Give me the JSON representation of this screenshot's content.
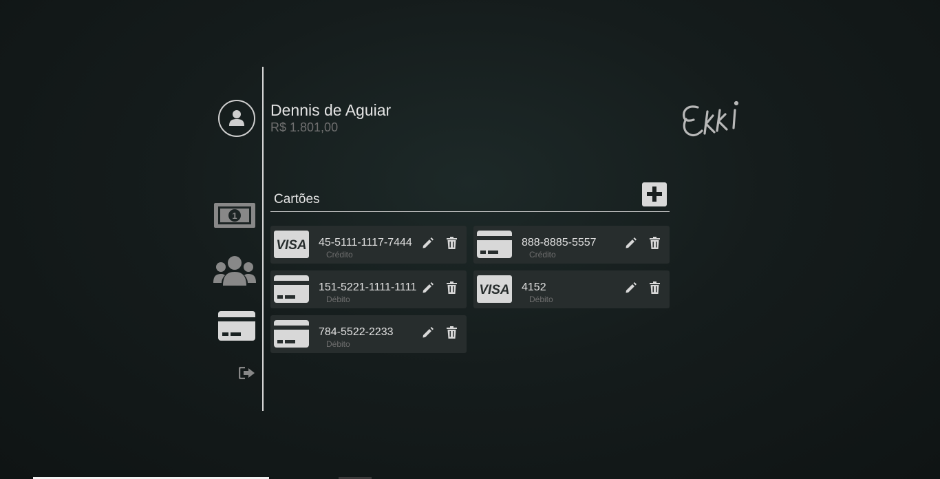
{
  "user": {
    "name": "Dennis de Aguiar",
    "balance": "R$ 1.801,00"
  },
  "logo": {
    "text": "Ekki"
  },
  "sidebar": {
    "items": [
      {
        "icon": "money-bill-icon"
      },
      {
        "icon": "users-icon"
      },
      {
        "icon": "credit-card-icon"
      },
      {
        "icon": "sign-out-icon"
      }
    ]
  },
  "cards_section": {
    "title": "Cartões",
    "add_icon": "plus-icon",
    "cards": [
      {
        "number": "45-5111-1117-7444",
        "type": "Crédito",
        "brand": "visa"
      },
      {
        "number": "888-8885-5557",
        "type": "Crédito",
        "brand": "generic"
      },
      {
        "number": "151-5221-1111-1111",
        "type": "Débito",
        "brand": "generic"
      },
      {
        "number": "4152",
        "type": "Débito",
        "brand": "visa"
      },
      {
        "number": "784-5522-2233",
        "type": "Débito",
        "brand": "generic"
      }
    ]
  },
  "colors": {
    "background": "#151c1c",
    "card_background": "#272d2d",
    "text_primary": "#e0e0e0",
    "text_muted": "#707070",
    "icon": "#d8d8d8"
  }
}
